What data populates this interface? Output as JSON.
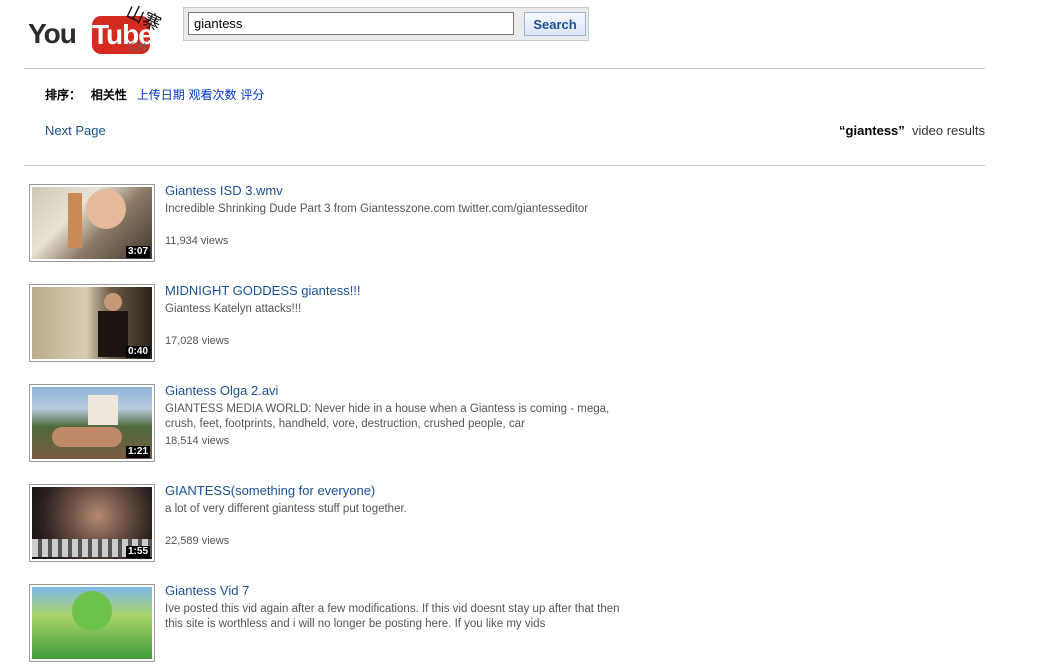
{
  "header": {
    "logo_you": "You",
    "logo_tube": "Tube",
    "logo_cn": "CN",
    "logo_stamp": "山寨",
    "search_value": "giantess",
    "search_button": "Search"
  },
  "sort": {
    "label": "排序：",
    "options": [
      "相关性",
      "上传日期",
      "观看次数",
      "评分"
    ],
    "active": "相关性"
  },
  "pagination": {
    "next_label": "Next Page"
  },
  "results_header": {
    "query": "“giantess”",
    "suffix": "video results"
  },
  "results": [
    {
      "title": "Giantess ISD 3.wmv",
      "desc": "Incredible Shrinking Dude Part 3 from Giantesszone.com twitter.com/giantesseditor",
      "views": "11,934 views",
      "duration": "3:07"
    },
    {
      "title": "MIDNIGHT GODDESS giantess!!!",
      "desc": "Giantess Katelyn attacks!!!",
      "views": "17,028 views",
      "duration": "0:40"
    },
    {
      "title": "Giantess Olga 2.avi",
      "desc": "GIANTESS MEDIA WORLD: Never hide in a house when a Giantess is coming - mega, crush, feet, footprints, handheld, vore, destruction, crushed people, car",
      "views": "18,514 views",
      "duration": "1:21"
    },
    {
      "title": "GIANTESS(something for everyone)",
      "desc": "a lot of very different giantess stuff put together.",
      "views": "22,589 views",
      "duration": "1:55"
    },
    {
      "title": "Giantess Vid 7",
      "desc": "Ive posted this vid again after a few modifications. If this vid doesnt stay up after that then this site is worthless and i will no longer be posting here. If you like my vids",
      "views": "",
      "duration": ""
    }
  ],
  "colors": {
    "link": "#1a4f95",
    "logo_red": "#d42a20"
  }
}
